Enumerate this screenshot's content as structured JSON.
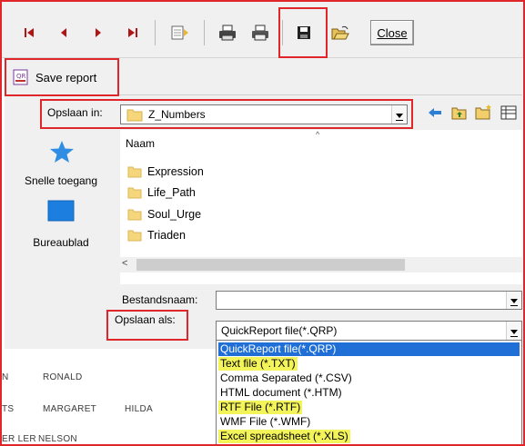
{
  "toolbar": {
    "close_label": "Close",
    "icons": [
      "first-page-icon",
      "prev-page-icon",
      "next-page-icon",
      "last-page-icon",
      "page-setup-icon",
      "printer-setup-icon",
      "print-icon",
      "save-icon",
      "open-icon"
    ]
  },
  "dialog": {
    "title": "Save report",
    "look_in_label": "Opslaan in:",
    "look_in_value": "Z_Numbers",
    "places": [
      {
        "label": "Snelle toegang",
        "icon": "star-icon"
      },
      {
        "label": "Bureaublad",
        "icon": "desktop-icon"
      }
    ],
    "column_header": "Naam",
    "files": [
      {
        "name": "Expression"
      },
      {
        "name": "Life_Path"
      },
      {
        "name": "Soul_Urge"
      },
      {
        "name": "Triaden"
      }
    ],
    "filename_label": "Bestandsnaam:",
    "filename_value": "",
    "saveas_label": "Opslaan als:",
    "saveas_value": "QuickReport file(*.QRP)",
    "saveas_options": [
      {
        "label": "QuickReport file(*.QRP)",
        "state": "selected"
      },
      {
        "label": "Text file (*.TXT)",
        "state": "highlight"
      },
      {
        "label": "Comma Separated (*.CSV)",
        "state": ""
      },
      {
        "label": "HTML document (*.HTM)",
        "state": ""
      },
      {
        "label": "RTF File (*.RTF)",
        "state": "highlight"
      },
      {
        "label": "WMF File (*.WMF)",
        "state": ""
      },
      {
        "label": "Excel spreadsheet (*.XLS)",
        "state": "highlight"
      }
    ]
  },
  "background_report": {
    "rows": [
      [
        "N",
        "RONALD",
        ""
      ],
      [
        "TS",
        "MARGARET",
        "HILDA"
      ],
      [
        "ER LER",
        "NELSON",
        ""
      ]
    ]
  },
  "colors": {
    "highlight_red": "#e0252b",
    "selection_blue": "#1f6fd6",
    "marker_yellow": "#f3f35a",
    "folder_yellow": "#f6d67a"
  }
}
